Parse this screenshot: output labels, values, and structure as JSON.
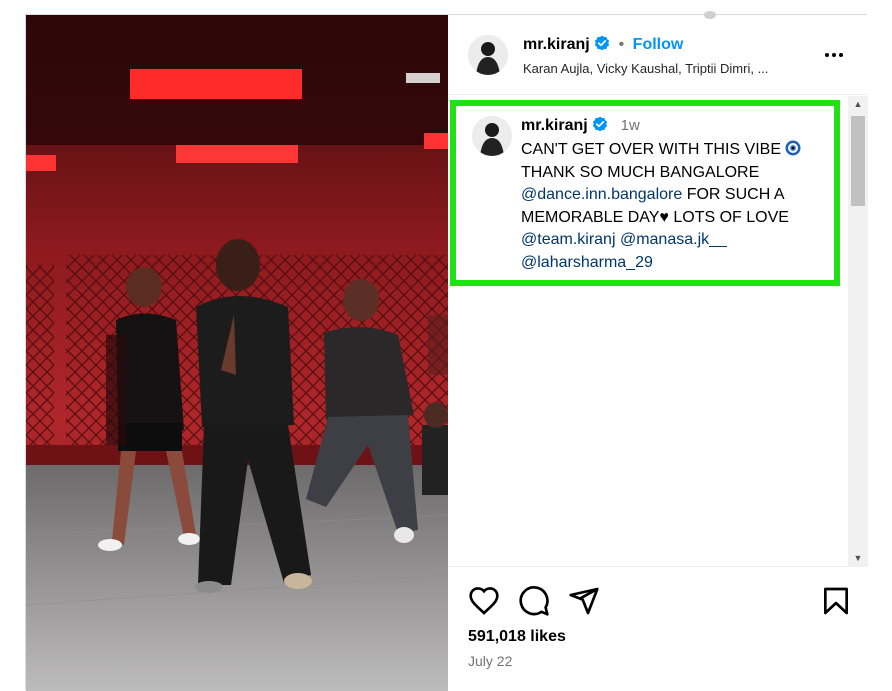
{
  "post": {
    "username": "mr.kiranj",
    "follow_label": "Follow",
    "separator": "•",
    "collab_line": "Karan Aujla, Vicky Kaushal, Triptii Dimri, ...",
    "more_icon": "more-options-icon"
  },
  "caption": {
    "username": "mr.kiranj",
    "time": "1w",
    "line1": "CAN'T GET OVER WITH THIS VIBE",
    "line2": "THANK SO MUCH BANGALORE",
    "mention1": "@dance.inn.bangalore",
    "text3": " FOR SUCH A MEMORABLE DAY",
    "heart": "♥",
    "text4": " LOTS OF LOVE",
    "mention2": "@team.kiranj",
    "mention3": "@manasa.jk__",
    "mention4": "@laharsharma_29",
    "highlight_color": "#22e014"
  },
  "actions": {
    "likes": "591,018 likes",
    "date": "July 22",
    "icons": [
      "heart-icon",
      "comment-icon",
      "share-icon",
      "bookmark-icon"
    ]
  },
  "colors": {
    "accent": "#0095f6",
    "mention": "#00376b",
    "muted": "#737373"
  }
}
